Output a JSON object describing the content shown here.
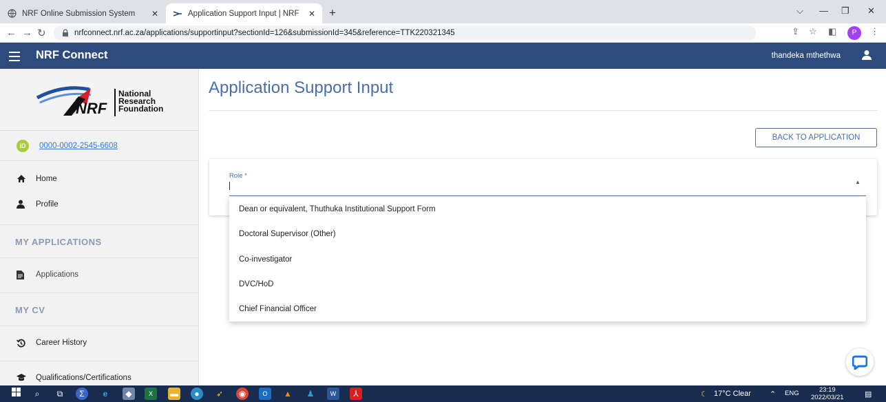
{
  "browser": {
    "tabs": [
      {
        "title": "NRF Online Submission System",
        "icon": "globe-icon"
      },
      {
        "title": "Application Support Input | NRF",
        "icon": "nrf-favicon"
      }
    ],
    "new_tab": "+",
    "url": "nrfconnect.nrf.ac.za/applications/supportinput?sectionId=126&submissionId=345&reference=TTK220321345",
    "profile_initial": "P"
  },
  "header": {
    "app_title": "NRF Connect",
    "user_name": "thandeka mthethwa"
  },
  "sidebar": {
    "logo_lines": [
      "National",
      "Research",
      "Foundation"
    ],
    "logo_mark": "NRF",
    "orcid_badge": "iD",
    "orcid": "0000-0002-2545-6608",
    "items": [
      {
        "label": "Home",
        "icon": "home-icon"
      },
      {
        "label": "Profile",
        "icon": "user-icon"
      }
    ],
    "section_applications": "MY APPLICATIONS",
    "applications_item": "Applications",
    "section_cv": "MY CV",
    "cv_items": [
      {
        "label": "Career History",
        "icon": "history-icon"
      },
      {
        "label": "Qualifications/Certifications",
        "icon": "graduation-cap-icon"
      }
    ]
  },
  "main": {
    "page_title": "Application Support Input",
    "back_button": "BACK TO APPLICATION",
    "role_label": "Role *",
    "role_value": "",
    "role_options": [
      "Dean or equivalent, Thuthuka Institutional Support Form",
      "Doctoral Supervisor (Other)",
      "Co-investigator",
      "DVC/HoD",
      "Chief Financial Officer"
    ]
  },
  "taskbar": {
    "weather": "17°C Clear",
    "language": "ENG",
    "time": "23:19",
    "date": "2022/03/21"
  },
  "colors": {
    "nav_bar": "#2d4b7d",
    "accent": "#4a6fa5",
    "orcid_green": "#a6ce39",
    "taskbar": "#172c4f"
  }
}
